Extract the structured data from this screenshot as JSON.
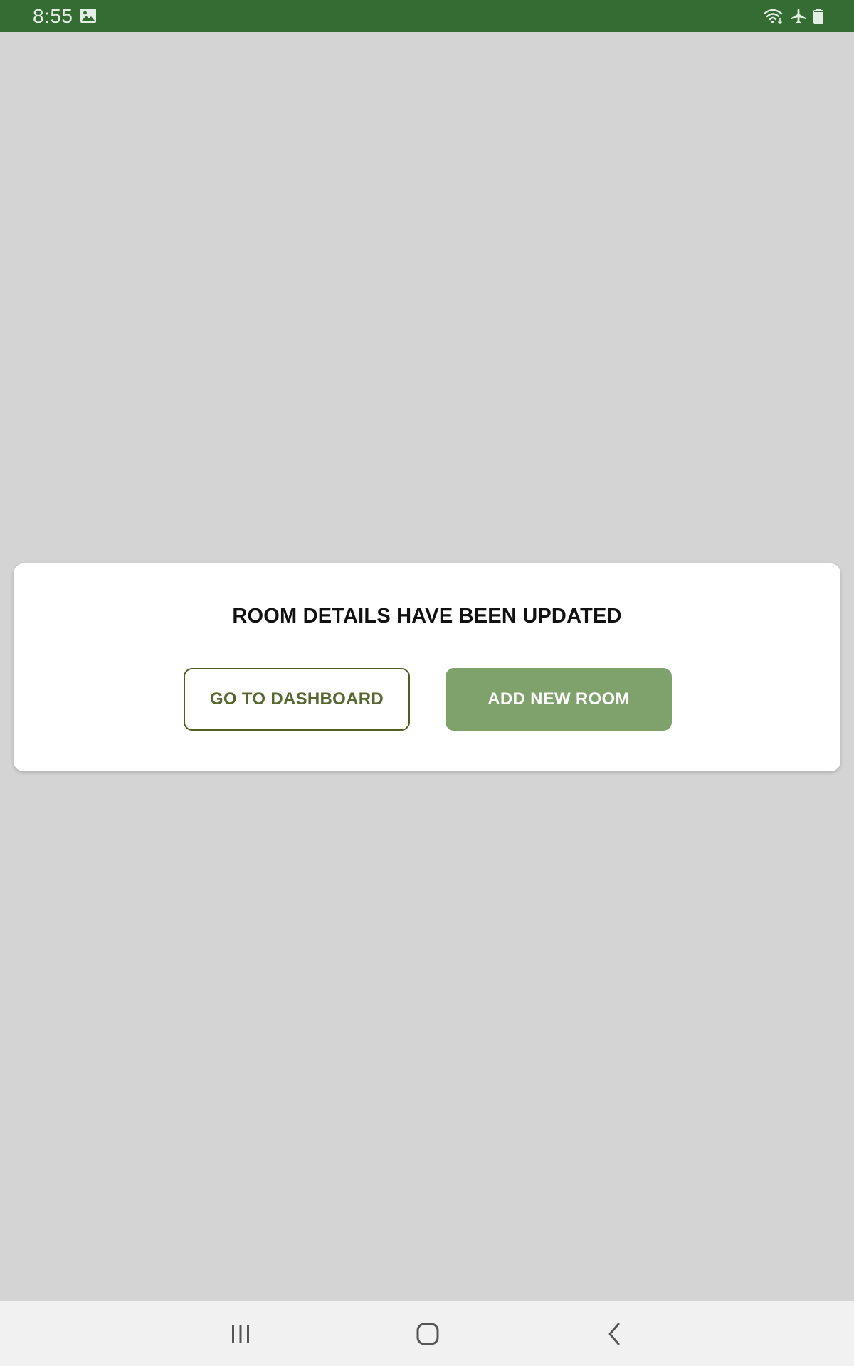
{
  "status_bar": {
    "time": "8:55",
    "color": "#346c33",
    "icons": [
      "gallery-icon",
      "wifi-icon",
      "airplane-mode-icon",
      "battery-icon"
    ]
  },
  "dialog": {
    "title": "ROOM DETAILS HAVE BEEN UPDATED",
    "go_to_dashboard_label": "GO TO DASHBOARD",
    "add_new_room_label": "ADD NEW ROOM",
    "outline_color": "#4f5f24",
    "accent_color": "#7fa26c"
  },
  "nav_bar": {
    "icons": [
      "recents-icon",
      "home-icon",
      "back-icon"
    ]
  }
}
